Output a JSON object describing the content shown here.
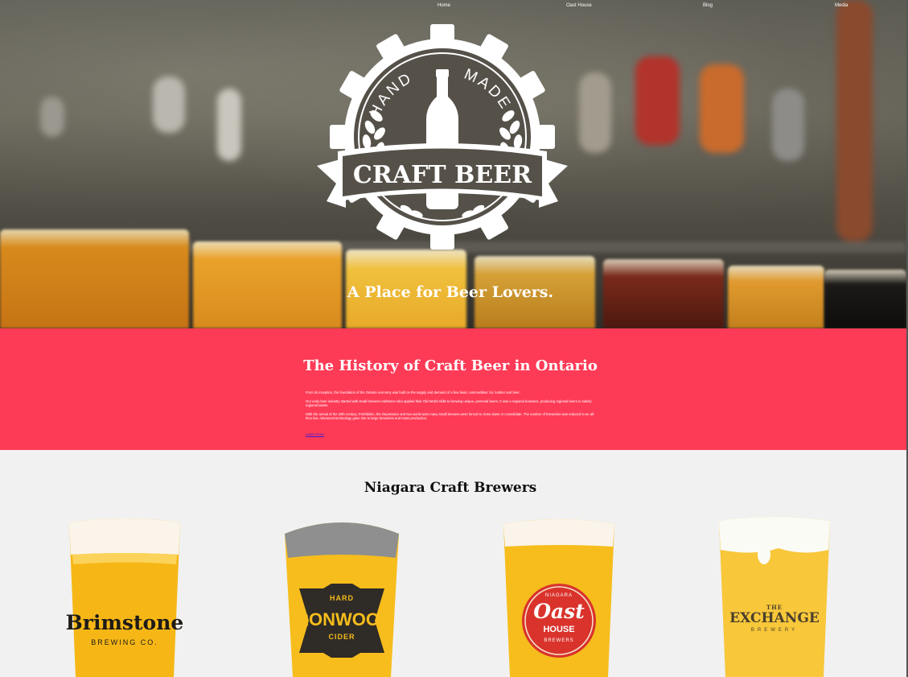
{
  "nav": {
    "items": [
      "Home",
      "Oast House",
      "Blog",
      "Media"
    ]
  },
  "hero": {
    "logo": {
      "top_text": "HAND MADE",
      "word_hand": "HAND",
      "word_made": "MADE",
      "banner_text": "CRAFT BEER"
    },
    "tagline": "A Place for Beer Lovers."
  },
  "history": {
    "title": "The History of Craft Beer in Ontario",
    "paragraphs": [
      "From its inception, the foundation of the Ontario economy was built on the supply and demand of a few basic commodities: fur, lumber and beer.",
      "Our early beer industry started with small brewers-craftsmen who applied their Old World skills to brewing unique, personal beers. It was a regional business, producing regional beers to satisfy regional tastes.",
      "With the arrival of the 20th century, Prohibition, the Depression and two world wars many small brewers were forced to close down or consolidate. The number of breweries was reduced to an all-time low. Advanced technology gave rise to large breweries and mass production."
    ],
    "link_label": "Learn more"
  },
  "brewers": {
    "title": "Niagara Craft Brewers",
    "items": [
      {
        "name": "Brimstone",
        "sub": "BREWING CO."
      },
      {
        "name": "IRONWOOD",
        "top": "HARD",
        "sub": "CIDER"
      },
      {
        "name": "Oast",
        "top": "NIAGARA",
        "mid": "HOUSE",
        "sub": "BREWERS"
      },
      {
        "name": "EXCHANGE",
        "top": "THE",
        "sub": "BREWERY"
      }
    ]
  },
  "colors": {
    "history_bg": "#fe3b56",
    "brewers_bg": "#f1f1f1",
    "beer": "#f5b918",
    "logo": "#ffffff"
  }
}
